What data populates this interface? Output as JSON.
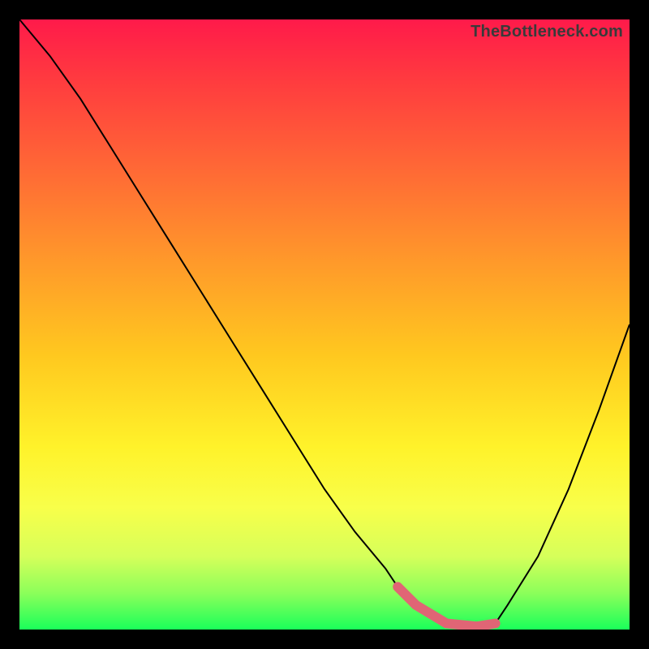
{
  "watermark": "TheBottleneck.com",
  "chart_data": {
    "type": "line",
    "title": "",
    "xlabel": "",
    "ylabel": "",
    "xlim": [
      0,
      100
    ],
    "ylim": [
      0,
      100
    ],
    "series": [
      {
        "name": "curve",
        "x": [
          0,
          5,
          10,
          15,
          20,
          25,
          30,
          35,
          40,
          45,
          50,
          55,
          60,
          62,
          65,
          70,
          75,
          78,
          80,
          85,
          90,
          95,
          100
        ],
        "y": [
          100,
          94,
          87,
          79,
          71,
          63,
          55,
          47,
          39,
          31,
          23,
          16,
          10,
          7,
          4,
          1,
          0.5,
          1,
          4,
          12,
          23,
          36,
          50
        ]
      }
    ],
    "highlight": {
      "name": "flat-bottom",
      "x": [
        62,
        65,
        70,
        75,
        78
      ],
      "y": [
        7,
        4,
        1,
        0.5,
        1
      ]
    }
  }
}
